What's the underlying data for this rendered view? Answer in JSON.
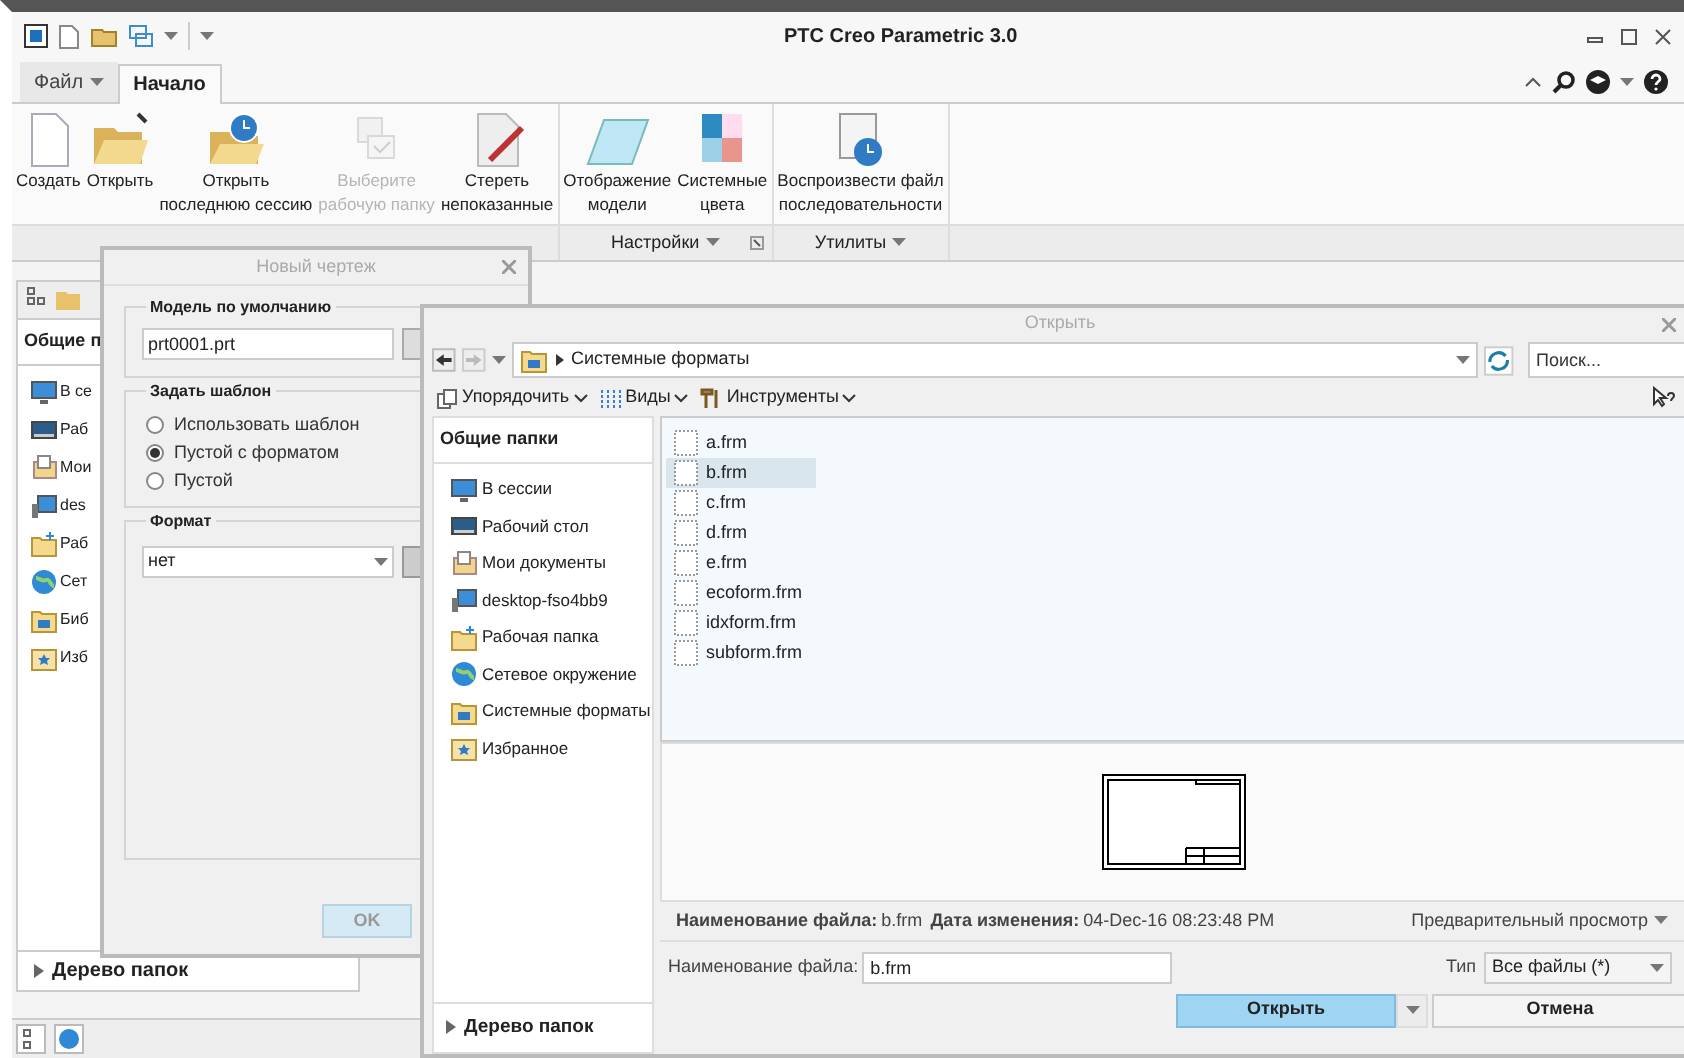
{
  "window": {
    "title": "PTC Creo Parametric 3.0"
  },
  "menu_tabs": [
    {
      "label": "Файл",
      "selected": false
    },
    {
      "label": "Начало",
      "selected": true
    }
  ],
  "ribbon_groups": [
    {
      "buttons": [
        {
          "lines": [
            "Создать"
          ],
          "disabled": false
        },
        {
          "lines": [
            "Открыть"
          ],
          "disabled": false
        },
        {
          "lines": [
            "Открыть",
            "последнюю сессию"
          ],
          "disabled": false
        },
        {
          "lines": [
            "Выберите",
            "рабочую папку"
          ],
          "disabled": true
        },
        {
          "lines": [
            "Стереть",
            "непоказанные"
          ],
          "disabled": false
        }
      ]
    },
    {
      "label": "Настройки",
      "buttons": [
        {
          "lines": [
            "Отображение",
            "модели"
          ],
          "disabled": false
        },
        {
          "lines": [
            "Системные",
            "цвета"
          ],
          "disabled": false
        }
      ]
    },
    {
      "label": "Утилиты",
      "buttons": [
        {
          "lines": [
            "Воспроизвести файл",
            "последовательности"
          ],
          "disabled": false
        }
      ]
    }
  ],
  "folder_panel": {
    "header": "Общие п",
    "items": [
      "В се",
      "Раб",
      "Мои",
      "des",
      "Раб",
      "Сет",
      "Биб",
      "Изб"
    ],
    "tree_label": "Дерево папок"
  },
  "new_drawing_dialog": {
    "title": "Новый чертеж",
    "default_model": {
      "label": "Модель по умолчанию",
      "value": "prt0001.prt"
    },
    "template": {
      "label": "Задать шаблон",
      "options": [
        {
          "label": "Использовать шаблон",
          "selected": false
        },
        {
          "label": "Пустой с форматом",
          "selected": true
        },
        {
          "label": "Пустой",
          "selected": false
        }
      ]
    },
    "format": {
      "label": "Формат",
      "value": "нет"
    },
    "ok_button": "OK"
  },
  "open_dialog": {
    "title": "Открыть",
    "path": "Системные форматы",
    "search": {
      "placeholder": "Поиск..."
    },
    "toolbar": [
      "Упорядочить",
      "Виды",
      "Инструменты"
    ],
    "sidebar": {
      "header": "Общие папки",
      "items": [
        "В сессии",
        "Рабочий стол",
        "Мои документы",
        "desktop-fso4bb9",
        "Рабочая папка",
        "Сетевое окружение",
        "Системные форматы",
        "Избранное"
      ],
      "tree_label": "Дерево папок"
    },
    "files": [
      {
        "name": "a.frm",
        "selected": false
      },
      {
        "name": "b.frm",
        "selected": true
      },
      {
        "name": "c.frm",
        "selected": false
      },
      {
        "name": "d.frm",
        "selected": false
      },
      {
        "name": "e.frm",
        "selected": false
      },
      {
        "name": "ecoform.frm",
        "selected": false
      },
      {
        "name": "idxform.frm",
        "selected": false
      },
      {
        "name": "subform.frm",
        "selected": false
      }
    ],
    "info": {
      "name_label": "Наименование файла:",
      "name_value": "b.frm",
      "date_label": "Дата изменения:",
      "date_value": "04-Dec-16 08:23:48 PM",
      "preview": "Предварительный просмотр"
    },
    "filename": {
      "label": "Наименование файла:",
      "value": "b.frm"
    },
    "type": {
      "label": "Тип",
      "value": "Все файлы (*)"
    },
    "open_button": "Открыть",
    "cancel_button": "Отмена"
  }
}
